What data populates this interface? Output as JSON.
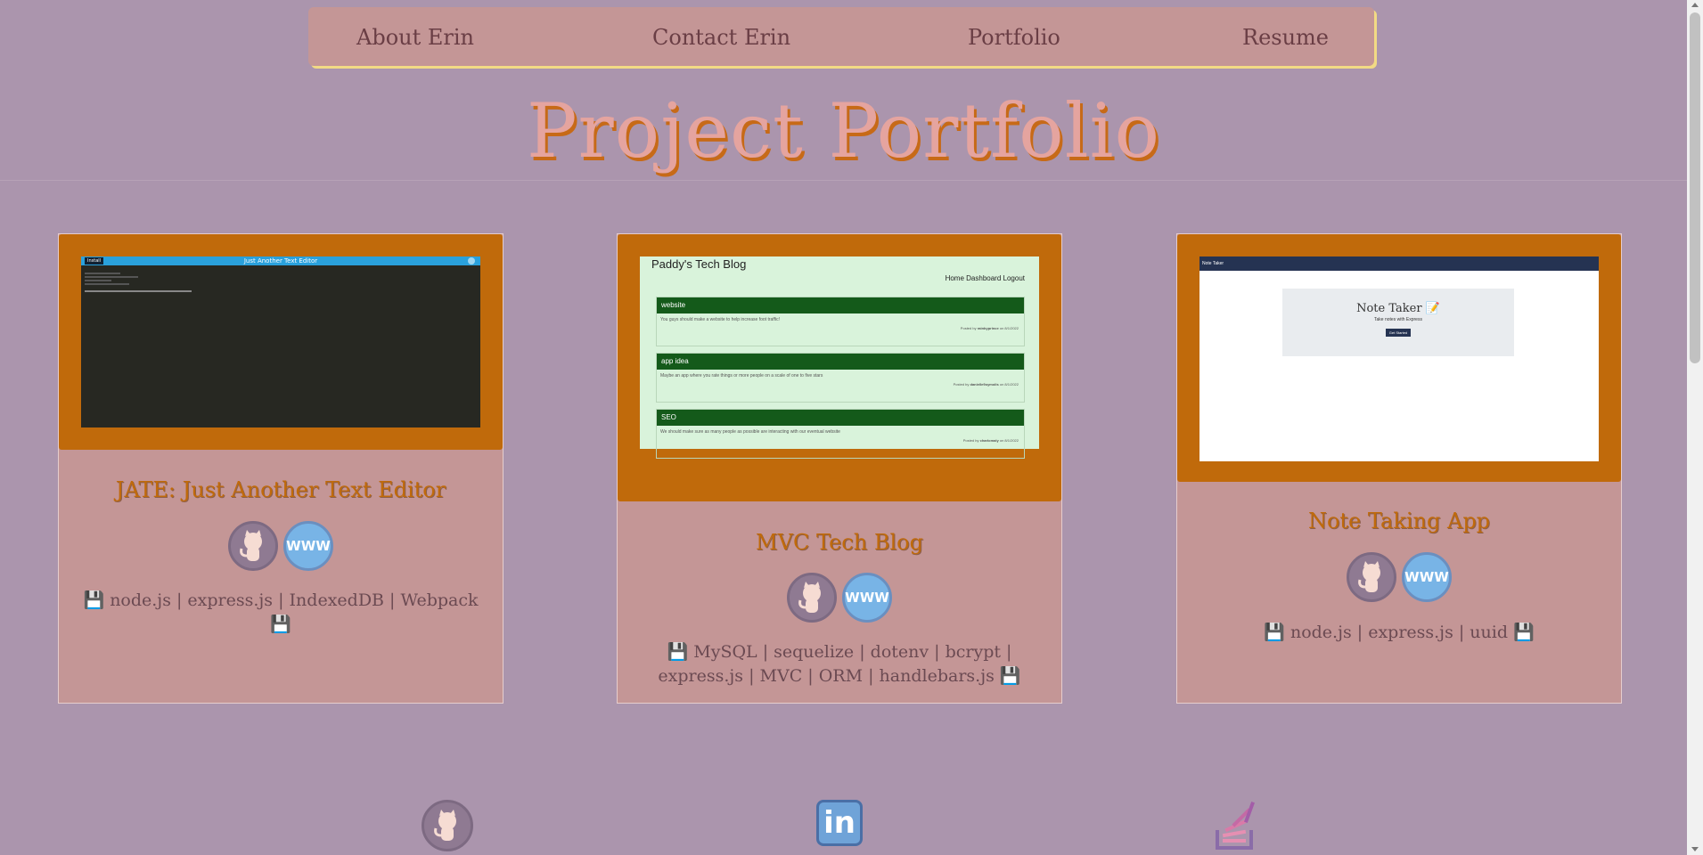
{
  "nav": {
    "about": "About Erin",
    "contact": "Contact Erin",
    "portfolio": "Portfolio",
    "resume": "Resume"
  },
  "hero": {
    "title": "Project Portfolio"
  },
  "projects": [
    {
      "title": "JATE: Just Another Text Editor",
      "tech": "node.js | express.js | IndexedDB | Webpack",
      "screenshot": {
        "app_title": "Just Another Text Editor",
        "button": "Install"
      },
      "github_icon": "github-octocat-icon",
      "web_icon": "www-globe-icon",
      "web_label": "WWW"
    },
    {
      "title": "MVC Tech Blog",
      "tech": "MySQL | sequelize | dotenv | bcrypt | express.js | MVC | ORM | handlebars.js",
      "screenshot": {
        "site_title": "Paddy's Tech Blog",
        "nav": [
          "Home",
          "Dashboard",
          "Logout"
        ],
        "posts": [
          {
            "title": "website",
            "body": "You guys should make a website to help increase foot traffic!",
            "meta_prefix": "Posted by",
            "author": "rainbyprince",
            "meta_suffix": "on 8/1/2022"
          },
          {
            "title": "app idea",
            "body": "Maybe an app where you rate things or more people on a scale of one to five stars",
            "meta_prefix": "Posted by",
            "author": "danielle9oymolis",
            "meta_suffix": "on 8/1/2022"
          },
          {
            "title": "SEO",
            "body": "We should make sure as many people as possible are interacting with our eventual website",
            "meta_prefix": "Posted by",
            "author": "charlomaly",
            "meta_suffix": "on 8/1/2022"
          }
        ]
      },
      "github_icon": "github-octocat-icon",
      "web_icon": "www-globe-icon",
      "web_label": "WWW"
    },
    {
      "title": "Note Taking App",
      "tech": "node.js | express.js | uuid",
      "screenshot": {
        "brand": "Note Taker",
        "heading": "Note Taker 📝",
        "subheading": "Take notes with Express",
        "button": "Get Started"
      },
      "github_icon": "github-octocat-icon",
      "web_icon": "www-globe-icon",
      "web_label": "WWW"
    }
  ],
  "footer": {
    "icons": [
      "github-octocat-icon",
      "linkedin-icon",
      "stackoverflow-icon"
    ],
    "linkedin_label": "in"
  },
  "colors": {
    "background": "#ab95ad",
    "nav_bg": "#c49696",
    "nav_shadow": "#f2da84",
    "card_bg": "#c49696",
    "frame": "#c06a0b",
    "title": "#e5a49f",
    "title_shadow": "#c76a17"
  },
  "symbols": {
    "floppy": "💾"
  }
}
